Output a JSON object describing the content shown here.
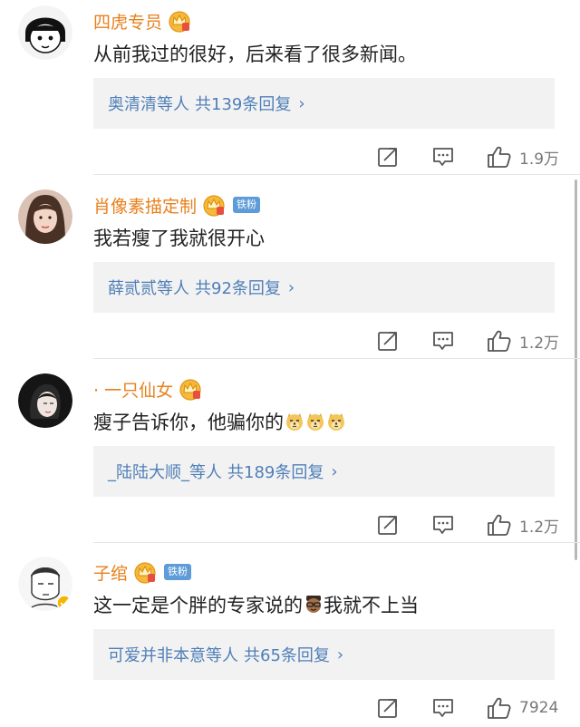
{
  "comments": [
    {
      "username": "四虎专员",
      "fan_badge": "",
      "text": "从前我过的很好，后来看了很多新闻。",
      "reply_names": "奥清清等人",
      "reply_count": "共139条回复",
      "likes": "1.9万"
    },
    {
      "username": "肖像素描定制",
      "fan_badge": "铁粉",
      "text": "我若瘦了我就很开心",
      "reply_names": "薛贰贰等人",
      "reply_count": "共92条回复",
      "likes": "1.2万"
    },
    {
      "username": "· 一只仙女",
      "fan_badge": "",
      "text": "瘦子告诉你，他骗你的",
      "reply_names": "_陆陆大顺_等人",
      "reply_count": "共189条回复",
      "likes": "1.2万"
    },
    {
      "username": "子绾",
      "fan_badge": "铁粉",
      "text": "这一定是个胖的专家说的",
      "text_after_emoji": "我就不上当",
      "reply_names": "可爱并非本意等人",
      "reply_count": "共65条回复",
      "likes": "7924"
    }
  ],
  "icons": {
    "chevron": "›",
    "share": "share-icon",
    "comment": "comment-icon",
    "like": "thumbs-up-icon",
    "crown": "crown-badge-icon"
  },
  "colors": {
    "username": "#e8801c",
    "link": "#4f7fb8",
    "reply_bg": "#f2f2f2",
    "fan_badge": "#5e9cd9"
  }
}
